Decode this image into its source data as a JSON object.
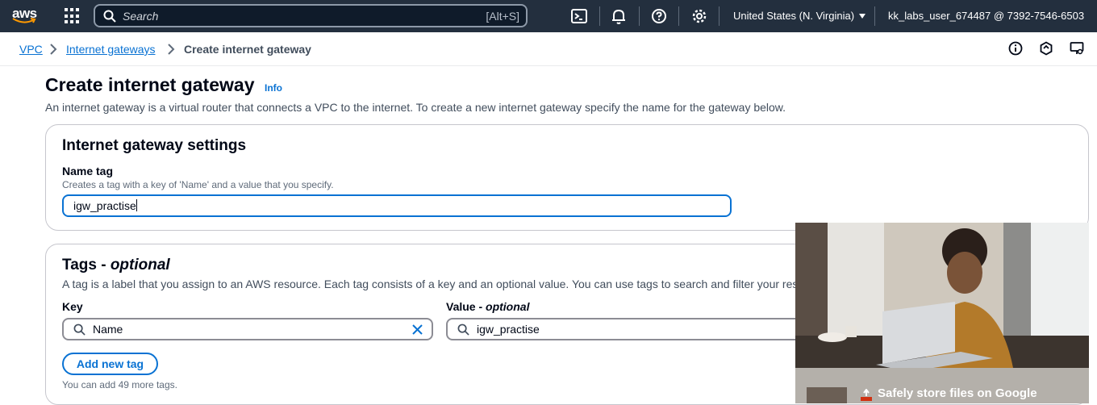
{
  "topbar": {
    "logo_text": "aws",
    "search_placeholder": "Search",
    "search_shortcut": "[Alt+S]",
    "region": "United States (N. Virginia)",
    "account": "kk_labs_user_674487 @ 7392-7546-6503"
  },
  "breadcrumb": {
    "items": [
      "VPC",
      "Internet gateways"
    ],
    "current": "Create internet gateway"
  },
  "page": {
    "title": "Create internet gateway",
    "info_label": "Info",
    "description": "An internet gateway is a virtual router that connects a VPC to the internet. To create a new internet gateway specify the name for the gateway below."
  },
  "settings": {
    "title": "Internet gateway settings",
    "name_label": "Name tag",
    "name_description": "Creates a tag with a key of 'Name' and a value that you specify.",
    "name_value": "igw_practise"
  },
  "tags": {
    "title_main": "Tags - ",
    "title_optional": "optional",
    "description": "A tag is a label that you assign to an AWS resource. Each tag consists of a key and an optional value. You can use tags to search and filter your resources or track your AWS costs.",
    "key_label": "Key",
    "value_label_main": "Value - ",
    "value_label_optional": "optional",
    "key_value": "Name",
    "value_value": "igw_practise",
    "add_button": "Add new tag",
    "limit_text": "You can add 49 more tags."
  },
  "ad": {
    "caption": "Safely store files on Google"
  },
  "colors": {
    "topbar_bg": "#232f3e",
    "link": "#0972d3",
    "text": "#000716"
  }
}
